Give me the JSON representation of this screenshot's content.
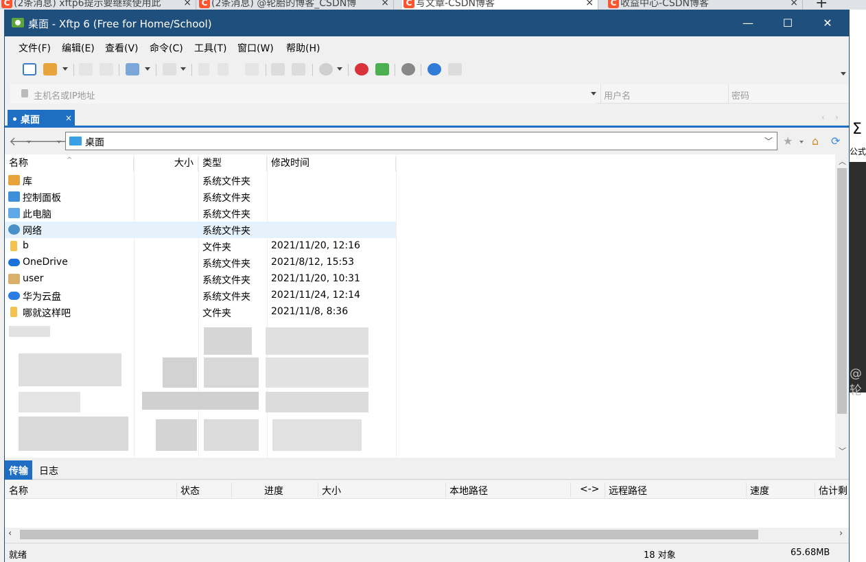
{
  "browser_tabs": [
    {
      "label": "(2条消息) xftp6提示要继续使用此"
    },
    {
      "label": "(2条消息) @轮胎的博客_CSDN博"
    },
    {
      "label": "写文章-CSDN博客"
    },
    {
      "label": "收益中心-CSDN博客"
    }
  ],
  "background_app": {
    "sigma": "Σ",
    "formula_label": "公式",
    "watermark": "@轮"
  },
  "window": {
    "title": "桌面 - Xftp 6 (Free for Home/School)",
    "controls": {
      "minimize": "—",
      "maximize": "☐",
      "close": "✕"
    }
  },
  "menu": [
    {
      "label": "文件(F)"
    },
    {
      "label": "编辑(E)"
    },
    {
      "label": "查看(V)"
    },
    {
      "label": "命令(C)"
    },
    {
      "label": "工具(T)"
    },
    {
      "label": "窗口(W)"
    },
    {
      "label": "帮助(H)"
    }
  ],
  "connection": {
    "host_placeholder": "主机名或IP地址",
    "user_placeholder": "用户名",
    "password_placeholder": "密码"
  },
  "session_tab": {
    "label": "桌面",
    "close": "×"
  },
  "tab_nav": {
    "prev": "‹",
    "next": "›"
  },
  "path": {
    "current": "桌面",
    "dropdown": "﹀"
  },
  "file_list": {
    "columns": [
      "名称",
      "大小",
      "类型",
      "修改时间"
    ],
    "rows": [
      {
        "name": "库",
        "size": "",
        "type": "系统文件夹",
        "modified": "",
        "icon": "library-icon"
      },
      {
        "name": "控制面板",
        "size": "",
        "type": "系统文件夹",
        "modified": "",
        "icon": "control-panel-icon"
      },
      {
        "name": "此电脑",
        "size": "",
        "type": "系统文件夹",
        "modified": "",
        "icon": "computer-icon"
      },
      {
        "name": "网络",
        "size": "",
        "type": "系统文件夹",
        "modified": "",
        "icon": "network-icon"
      },
      {
        "name": "b",
        "size": "",
        "type": "文件夹",
        "modified": "2021/11/20, 12:16",
        "icon": "folder-icon"
      },
      {
        "name": "OneDrive",
        "size": "",
        "type": "系统文件夹",
        "modified": "2021/8/12, 15:53",
        "icon": "cloud-icon"
      },
      {
        "name": "user",
        "size": "",
        "type": "系统文件夹",
        "modified": "2021/11/20, 10:31",
        "icon": "user-folder-icon"
      },
      {
        "name": "华为云盘",
        "size": "",
        "type": "系统文件夹",
        "modified": "2021/11/24, 12:14",
        "icon": "cloud-drive-icon"
      },
      {
        "name": "哪就这样吧",
        "size": "",
        "type": "文件夹",
        "modified": "2021/11/8, 8:36",
        "icon": "folder-icon"
      }
    ],
    "selected_index": 3
  },
  "transfer": {
    "tabs": [
      "传输",
      "日志"
    ],
    "columns": [
      "名称",
      "状态",
      "进度",
      "大小",
      "本地路径",
      "<->",
      "远程路径",
      "速度",
      "估计剩"
    ]
  },
  "status": {
    "state": "就绪",
    "count": "18 对象",
    "size": "65.68MB"
  },
  "colors": {
    "titlebar": "#1f4f7d",
    "accent": "#1e6fc4",
    "selection": "#e5f1fb"
  }
}
